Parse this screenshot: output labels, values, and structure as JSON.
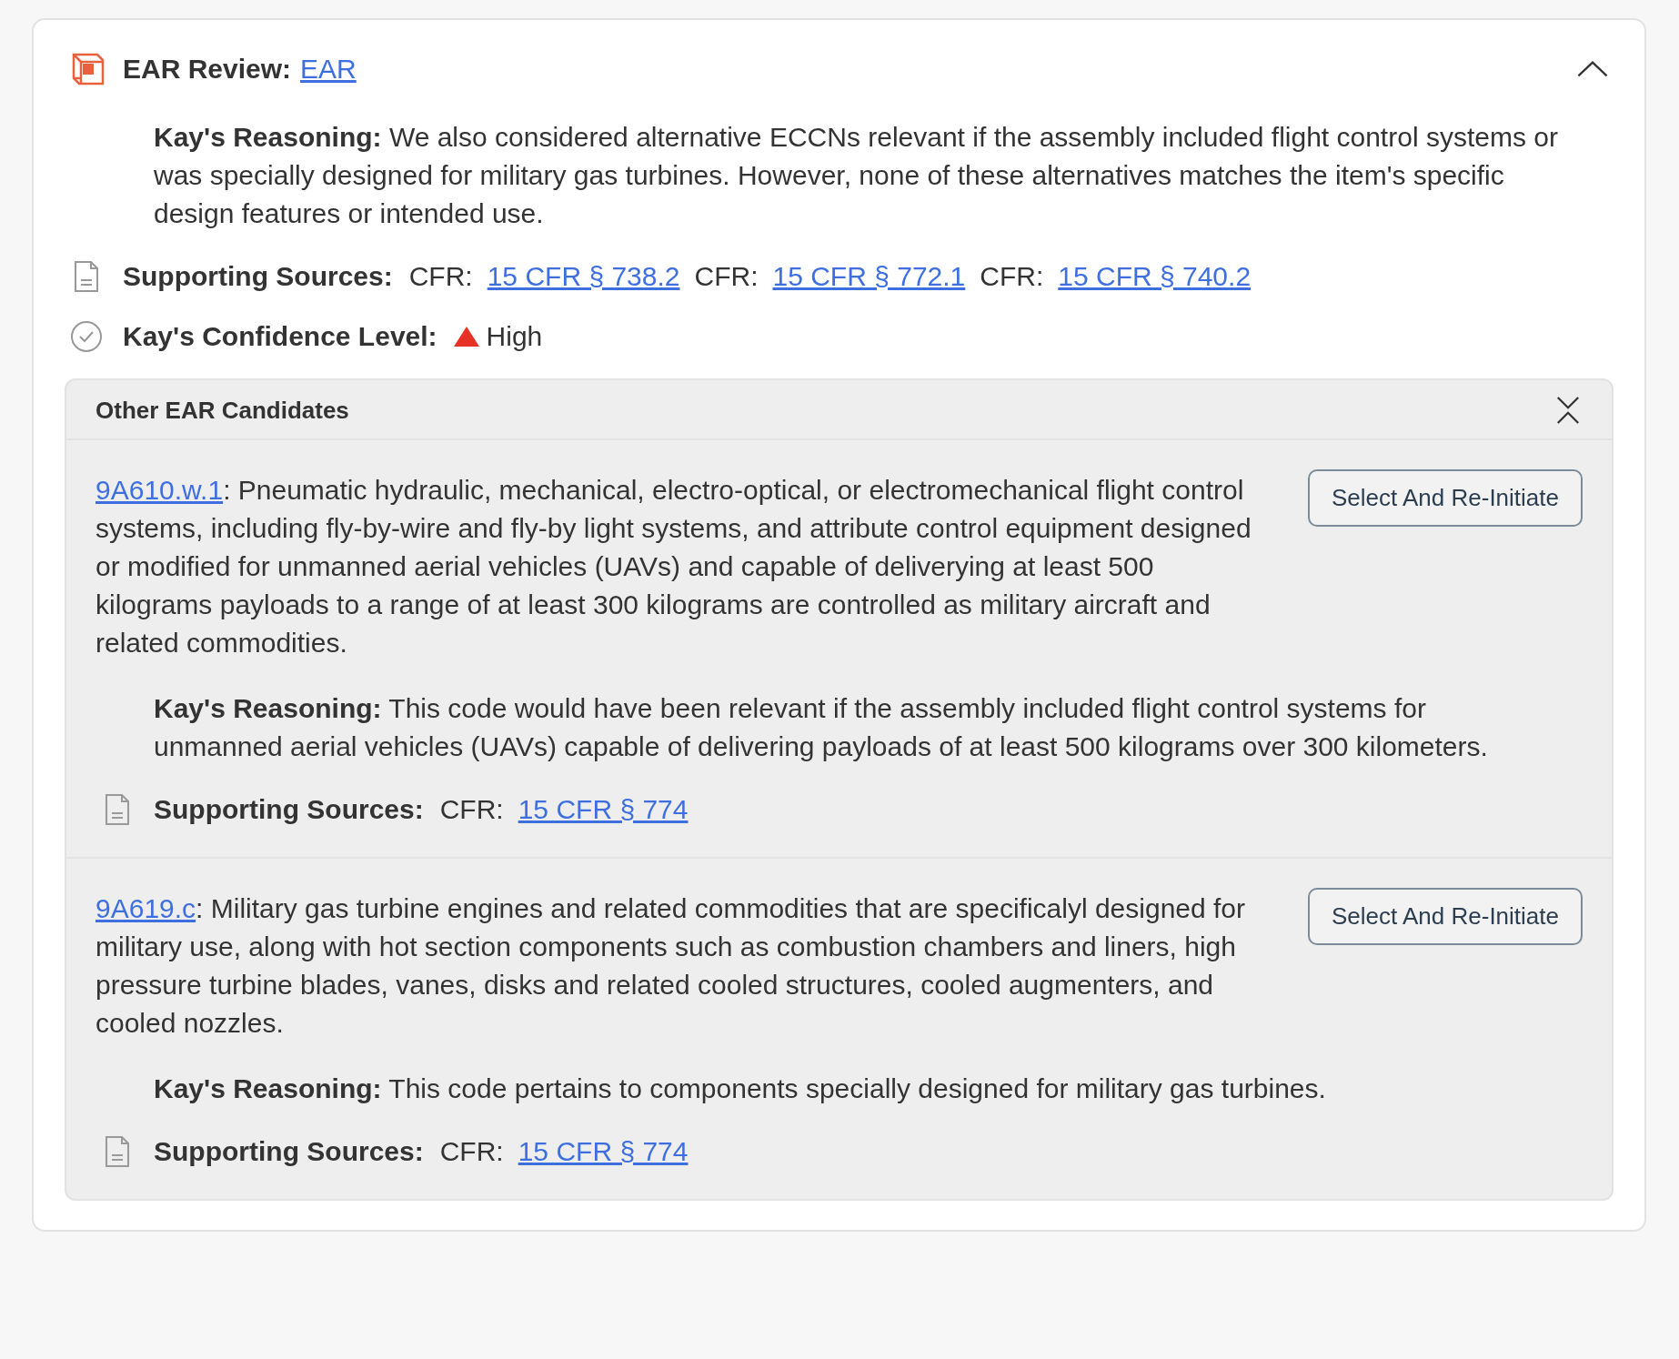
{
  "review": {
    "title": "EAR Review:",
    "link": "EAR",
    "expanded": true,
    "reasoning": {
      "label": "Kay's Reasoning:",
      "text": "We also considered alternative ECCNs relevant if the assembly included flight control systems or was specially designed for military gas turbines. However, none of these alternatives matches the item's specific design features or intended use."
    },
    "sources": {
      "label": "Supporting Sources:",
      "items": [
        {
          "prefix": "CFR:",
          "link": "15 CFR § 738.2"
        },
        {
          "prefix": "CFR:",
          "link": "15 CFR § 772.1"
        },
        {
          "prefix": "CFR:",
          "link": "15 CFR § 740.2"
        }
      ]
    },
    "confidence": {
      "label": "Kay's Confidence Level:",
      "value": "High",
      "kind": "high"
    }
  },
  "candidates": {
    "title": "Other EAR Candidates",
    "expanded": true,
    "items": [
      {
        "code": "9A610.w.1",
        "description": ": Pneumatic hydraulic, mechanical, electro-optical, or electromechanical flight control systems, including fly-by-wire and fly-by light systems, and attribute control equipment designed or modified for unmanned aerial vehicles (UAVs) and capable of deliverying at least 500 kilograms payloads to a range of at least 300 kilograms are controlled as military aircraft and related commodities.",
        "button": "Select And Re-Initiate",
        "reasoning": {
          "label": "Kay's Reasoning:",
          "text": "This code would have been relevant if the assembly included flight control systems for unmanned aerial vehicles (UAVs) capable of delivering payloads of at least 500 kilograms over 300 kilometers."
        },
        "sources": {
          "label": "Supporting Sources:",
          "items": [
            {
              "prefix": "CFR:",
              "link": "15 CFR § 774"
            }
          ]
        }
      },
      {
        "code": "9A619.c",
        "description": ": Military gas turbine engines and related commodities that are specificalyl designed for military use, along with hot section components such as combustion chambers and liners, high pressure turbine blades, vanes, disks and related cooled structures, cooled augmenters, and cooled nozzles.",
        "button": "Select And Re-Initiate",
        "reasoning": {
          "label": "Kay's Reasoning:",
          "text": "This code pertains to components specially designed for military gas turbines."
        },
        "sources": {
          "label": "Supporting Sources:",
          "items": [
            {
              "prefix": "CFR:",
              "link": "15 CFR § 774"
            }
          ]
        }
      }
    ]
  }
}
